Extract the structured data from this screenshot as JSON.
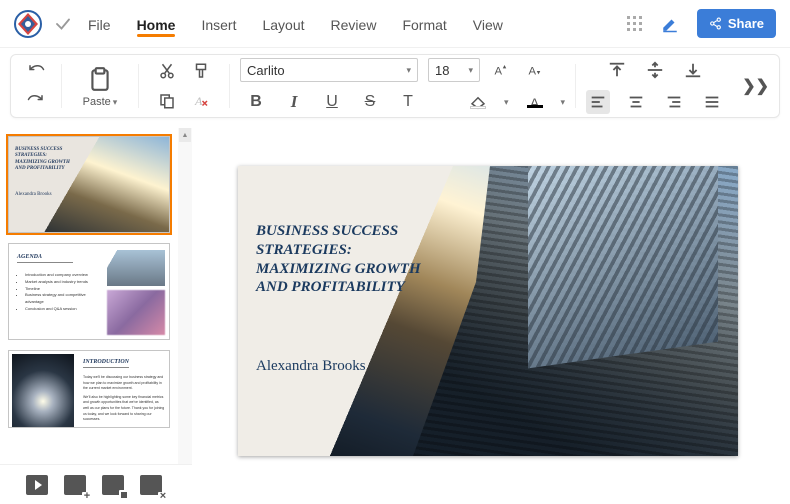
{
  "menu": {
    "tabs": [
      "File",
      "Home",
      "Insert",
      "Layout",
      "Review",
      "Format",
      "View"
    ],
    "active": "Home",
    "share_label": "Share"
  },
  "toolbar": {
    "paste_label": "Paste",
    "font_name": "Carlito",
    "font_size": "18"
  },
  "slides": {
    "main": {
      "title": "BUSINESS SUCCESS STRATEGIES: MAXIMIZING GROWTH AND PROFITABILITY",
      "author": "Alexandra Brooks"
    },
    "thumb1": {
      "title": "BUSINESS SUCCESS STRATEGIES: MAXIMIZING GROWTH AND PROFITABILITY",
      "author": "Alexandra Brooks"
    },
    "thumb2": {
      "title": "AGENDA",
      "bullets": [
        "Introduction and company overview",
        "Market analysis and industry trends",
        "Timeline",
        "Business strategy and competitive advantage",
        "Conclusion and Q&A session"
      ]
    },
    "thumb3": {
      "title": "INTRODUCTION",
      "p1": "Today we'll be discussing our business strategy and how we plan to maximize growth and profitability in the current market environment.",
      "p2": "We'll also be highlighting some key financial metrics and growth opportunities that we've identified, as well as our plans for the future. Thank you for joining us today, and we look forward to sharing our successes."
    }
  }
}
